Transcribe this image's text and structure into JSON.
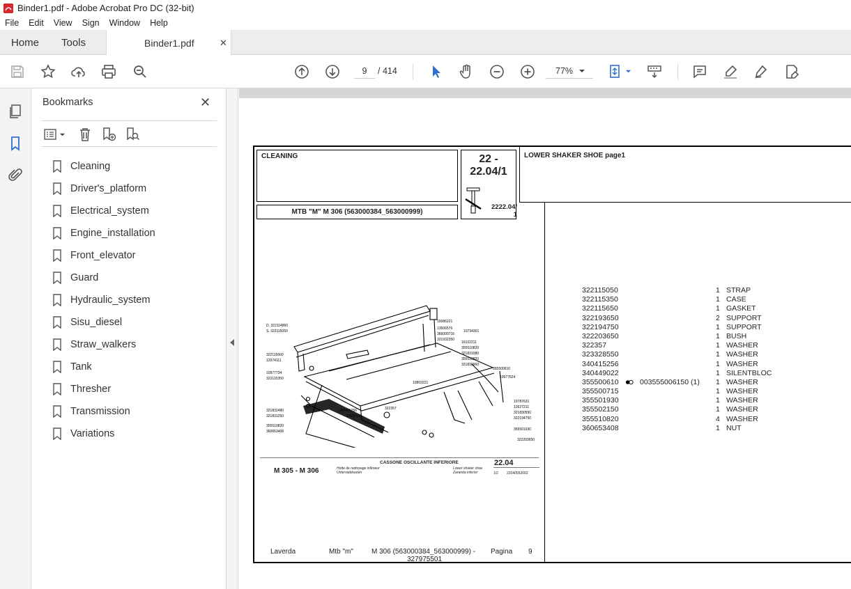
{
  "window": {
    "title": "Binder1.pdf - Adobe Acrobat Pro DC (32-bit)"
  },
  "menu": [
    "File",
    "Edit",
    "View",
    "Sign",
    "Window",
    "Help"
  ],
  "tabs": {
    "home": "Home",
    "tools": "Tools",
    "document": "Binder1.pdf"
  },
  "toolbar": {
    "current_page": "9",
    "total_pages": "/ 414",
    "zoom": "77%"
  },
  "bookmarks": {
    "title": "Bookmarks",
    "items": [
      "Cleaning",
      "Driver's_platform",
      "Electrical_system",
      "Engine_installation",
      "Front_elevator",
      "Guard",
      "Hydraulic_system",
      "Sisu_diesel",
      "Straw_walkers",
      "Tank",
      "Thresher",
      "Transmission",
      "Variations"
    ]
  },
  "pdf": {
    "section": "CLEANING",
    "ref_number": "22 -\n22.04/1",
    "ref_small": "2222.04/\n1",
    "page_title": "LOWER SHAKER SHOE  page1",
    "model": "MTB \"M\" M 306 (563000384_563000999)",
    "drawing": {
      "model_label": "M 305 - M 306",
      "caption_it": "CASSONE OSCILLANTE INFERIORE",
      "caption_fr": "Hotte de nettoyage inférieur",
      "caption_de": "Untersiebkasten",
      "caption_en": "Lower shaker shoe",
      "caption_es": "Zaranda inferior",
      "group": "22.04",
      "sheet": "1/2",
      "drawing_no": "22040552002"
    },
    "parts": [
      {
        "num": "322115050",
        "qty": "1",
        "desc": "STRAP"
      },
      {
        "num": "322115350",
        "qty": "1",
        "desc": "CASE"
      },
      {
        "num": "322115650",
        "qty": "1",
        "desc": "GASKET"
      },
      {
        "num": "322193650",
        "qty": "2",
        "desc": "SUPPORT"
      },
      {
        "num": "322194750",
        "qty": "1",
        "desc": "SUPPORT"
      },
      {
        "num": "322203650",
        "qty": "1",
        "desc": "BUSH"
      },
      {
        "num": "322357",
        "qty": "1",
        "desc": "WASHER"
      },
      {
        "num": "323328550",
        "qty": "1",
        "desc": "WASHER"
      },
      {
        "num": "340415256",
        "qty": "1",
        "desc": "WASHER"
      },
      {
        "num": "340449022",
        "qty": "1",
        "desc": "SILENTBLOC"
      },
      {
        "num": "355500610",
        "alt": "003555006150  (1)",
        "qty": "1",
        "desc": "WASHER"
      },
      {
        "num": "355500715",
        "qty": "1",
        "desc": "WASHER"
      },
      {
        "num": "355501930",
        "qty": "1",
        "desc": "WASHER"
      },
      {
        "num": "355502150",
        "qty": "1",
        "desc": "WASHER"
      },
      {
        "num": "355510820",
        "qty": "4",
        "desc": "WASHER"
      },
      {
        "num": "360653408",
        "qty": "1",
        "desc": "NUT"
      }
    ],
    "footer": {
      "brand": "Laverda",
      "series": "Mtb \"m\"",
      "model_range": "M 306 (563000384_563000999)  -",
      "code": "327975501",
      "page_label": "Pagina",
      "page_no": "9"
    }
  }
}
